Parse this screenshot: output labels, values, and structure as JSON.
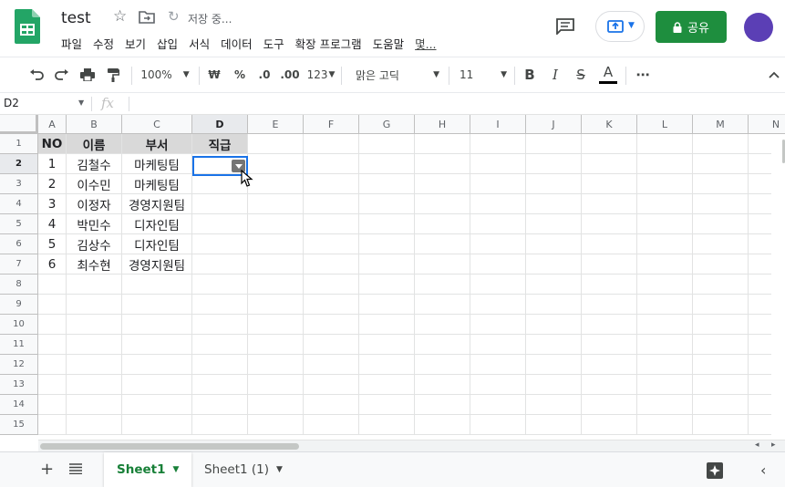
{
  "header": {
    "title": "test",
    "save_status": "저장 중...",
    "menu": [
      "파일",
      "수정",
      "보기",
      "삽입",
      "서식",
      "데이터",
      "도구",
      "확장 프로그램",
      "도움말",
      "몇..."
    ],
    "share_label": "공유",
    "accent_color": "#1e8e3e"
  },
  "toolbar": {
    "zoom": "100%",
    "currency": "₩",
    "percent": "%",
    "dec_decrease": ".0",
    "dec_increase": ".00",
    "number_format": "123",
    "font_family": "맑은 고딕",
    "font_size": "11",
    "bold": "B",
    "italic": "I",
    "strike": "S",
    "text_color": "A",
    "more": "⋯"
  },
  "formula_bar": {
    "cell_ref": "D2",
    "fx": "fx"
  },
  "grid": {
    "columns": [
      "A",
      "B",
      "C",
      "D",
      "E",
      "F",
      "G",
      "H",
      "I",
      "J",
      "K",
      "L",
      "M",
      "N"
    ],
    "rows": [
      "1",
      "2",
      "3",
      "4",
      "5",
      "6",
      "7",
      "8",
      "9",
      "10",
      "11",
      "12",
      "13",
      "14",
      "15"
    ],
    "header_row": [
      "NO",
      "이름",
      "부서",
      "직급"
    ],
    "data": [
      [
        "1",
        "김철수",
        "마케팅팀",
        ""
      ],
      [
        "2",
        "이수민",
        "마케팅팀",
        ""
      ],
      [
        "3",
        "이정자",
        "경영지원팀",
        ""
      ],
      [
        "4",
        "박민수",
        "디자인팀",
        ""
      ],
      [
        "5",
        "김상수",
        "디자인팀",
        ""
      ],
      [
        "6",
        "최수현",
        "경영지원팀",
        ""
      ]
    ],
    "selected_cell": "D2"
  },
  "tabs": {
    "sheets": [
      "Sheet1",
      "Sheet1 (1)"
    ],
    "active": "Sheet1"
  }
}
